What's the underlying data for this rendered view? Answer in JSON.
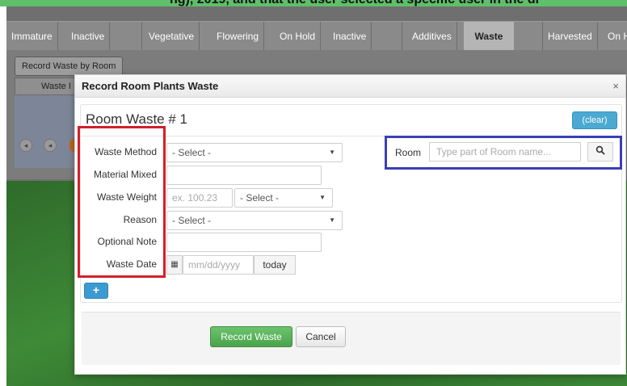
{
  "background": {
    "top_snippet": "ng), 2019, and that the user selected a specific user in the dr",
    "tabs": [
      "Immature",
      "Inactive",
      "",
      "Vegetative",
      "Flowering",
      "On Hold",
      "Inactive",
      "",
      "Additives",
      "Waste",
      "",
      "Harvested",
      "On H"
    ],
    "active_tab": "Waste",
    "record_by_room_label": "Record Waste by Room",
    "grid_header": "Waste I"
  },
  "modal": {
    "title": "Record Room Plants Waste",
    "close_glyph": "×",
    "room_heading": "Room Waste # 1",
    "clear_label": "(clear)"
  },
  "form": {
    "waste_method": {
      "label": "Waste Method",
      "value": "- Select -"
    },
    "material_mixed": {
      "label": "Material Mixed",
      "value": ""
    },
    "waste_weight": {
      "label": "Waste Weight",
      "placeholder": "ex. 100.23",
      "unit_value": "- Select -"
    },
    "reason": {
      "label": "Reason",
      "value": "- Select -"
    },
    "optional_note": {
      "label": "Optional Note",
      "value": ""
    },
    "waste_date": {
      "label": "Waste Date",
      "placeholder": "mm/dd/yyyy",
      "today_label": "today"
    }
  },
  "room": {
    "label": "Room",
    "placeholder": "Type part of Room name..."
  },
  "actions": {
    "add_label": "+",
    "record_label": "Record Waste",
    "cancel_label": "Cancel"
  },
  "colors": {
    "annotation_red": "#d2202a",
    "annotation_blue": "#3a3fb4",
    "primary_green": "#4aa34c",
    "info_blue": "#4ba9d2"
  },
  "icons": {
    "close": "close-icon",
    "caret": "chevron-down-icon",
    "calendar": "calendar-icon",
    "search": "search-icon",
    "add": "plus-icon"
  }
}
